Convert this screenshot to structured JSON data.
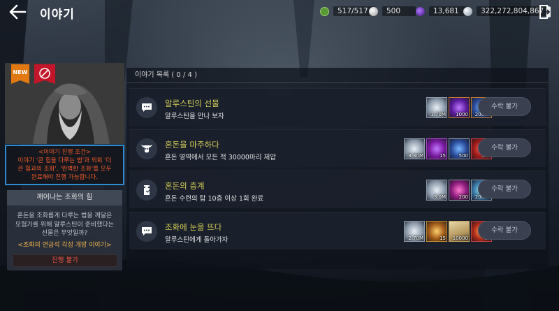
{
  "header": {
    "title": "이야기",
    "resources": [
      {
        "icon": "stamina-icon",
        "value": "517/517",
        "color": "#7bbf4a"
      },
      {
        "icon": "pearl-icon",
        "value": "500",
        "color": "#c8c8c8"
      },
      {
        "icon": "crystal-icon",
        "value": "13,681",
        "color": "#7a3fd0"
      },
      {
        "icon": "silver-coin-icon",
        "value": "322,272,804,867",
        "color": "#b8c8d8"
      }
    ]
  },
  "left": {
    "badge_new": "NEW",
    "condition_lines": [
      "<이야기 진행 조건>",
      "이야기 '큰 힘을 다루는 법'과 외회 '더",
      "큰 힘과의 조화', '완벽한 조화'를 모두",
      "완료해야 진행 가능합니다."
    ],
    "story_title": "깨어나는 조화의 힘",
    "story_desc_lines": [
      "혼돈을 조화롭게 다루는 법을 깨달은",
      "모험가를 위해 알루스틴이 준비했다는",
      "선물은 무엇일까?"
    ],
    "unlock_text": "<조화의 연금석 각성 개방 이야기>",
    "proceed_label": "진행 불가"
  },
  "list": {
    "header": "이야기 목록 ( 0 / 4 )",
    "quests": [
      {
        "icon": "chat-bubble-icon",
        "title": "알루스틴의 선물",
        "subtitle": "알루스틴을 만나 보자",
        "claim_label": "수락 불가",
        "rewards": [
          {
            "name": "silver-coin",
            "count": "1.70M",
            "color": "#aab6c4"
          },
          {
            "name": "purple-crystal",
            "count": "1000",
            "color": "#6a2fb0"
          },
          {
            "name": "blue-orb",
            "count": "20000",
            "color": "#2a6ab0"
          }
        ]
      },
      {
        "icon": "bull-skull-icon",
        "title": "혼돈을 마주하다",
        "subtitle": "혼돈 영역에서 모든 적 30000마리 제압",
        "claim_label": "수락 불가",
        "rewards": [
          {
            "name": "silver-coin",
            "count": "3.30M",
            "color": "#aab6c4"
          },
          {
            "name": "purple-chest",
            "count": "15",
            "color": "#8a2fb0"
          },
          {
            "name": "blue-orb",
            "count": "500",
            "color": "#2a6ab0"
          },
          {
            "name": "red-chest",
            "count": "300",
            "color": "#a82020"
          }
        ]
      },
      {
        "icon": "tower-icon",
        "title": "혼돈의 층계",
        "subtitle": "혼돈 수련의 탑 10층 이상 1회 완료",
        "claim_label": "수락 불가",
        "rewards": [
          {
            "name": "silver-coin",
            "count": "3.0M",
            "color": "#aab6c4"
          },
          {
            "name": "pink-crystal",
            "count": "200",
            "color": "#b02f8a"
          },
          {
            "name": "blue-orb",
            "count": "20000",
            "color": "#2a6ab0"
          }
        ]
      },
      {
        "icon": "chat-bubble-icon",
        "title": "조화에 눈을 뜨다",
        "subtitle": "알루스틴에게 돌아가자",
        "claim_label": "수락 불가",
        "rewards": [
          {
            "name": "silver-coin",
            "count": "2.70M",
            "color": "#aab6c4"
          },
          {
            "name": "gold-gem",
            "count": "15",
            "color": "#c08a20"
          },
          {
            "name": "scroll",
            "count": "10000",
            "color": "#c8a870"
          },
          {
            "name": "fire-gem",
            "count": "10",
            "color": "#b03020"
          }
        ]
      }
    ]
  }
}
